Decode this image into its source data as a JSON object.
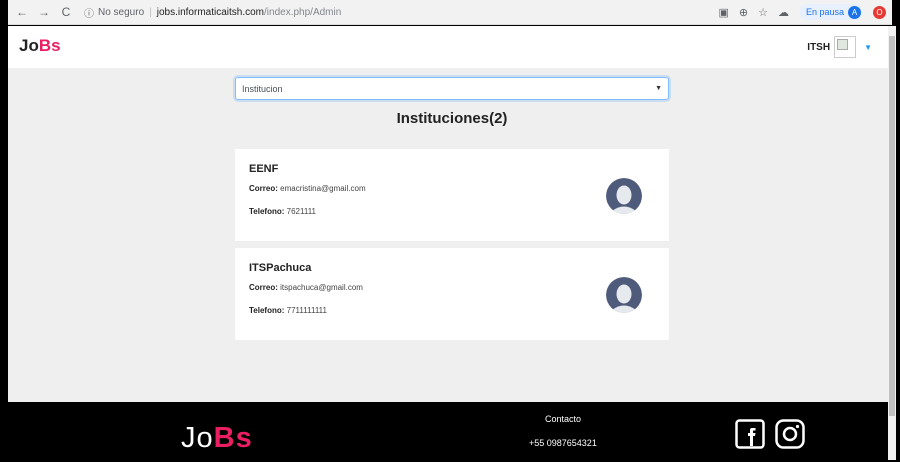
{
  "browser": {
    "back": "←",
    "forward": "→",
    "reload": "C",
    "security_label": "No seguro",
    "url_host": "jobs.informaticaitsh.com",
    "url_path": "/index.php/Admin",
    "pause_label": "En pausa",
    "profile_initial": "A",
    "opera_glyph": "O"
  },
  "navbar": {
    "brand_prefix": "Jo",
    "brand_suffix": "Bs",
    "user_name": "ITSH"
  },
  "filter": {
    "selected": "Institucion"
  },
  "heading": "Instituciones(2)",
  "institutions": [
    {
      "name": "EENF",
      "email_label": "Correo:",
      "email": "emacristina@gmail.com",
      "phone_label": "Telefono:",
      "phone": "7621111"
    },
    {
      "name": "ITSPachuca",
      "email_label": "Correo:",
      "email": "itspachuca@gmail.com",
      "phone_label": "Telefono:",
      "phone": "7711111111"
    }
  ],
  "footer": {
    "brand_prefix": "Jo",
    "brand_suffix": "Bs",
    "contact_title": "Contacto",
    "phone": "+55 0987654321",
    "social": [
      "facebook-icon",
      "instagram-icon"
    ]
  },
  "colors": {
    "brand_pink": "#e91e63",
    "page_bg": "#efefef",
    "footer_bg": "#000000",
    "avatar": "#4f5b7a"
  }
}
